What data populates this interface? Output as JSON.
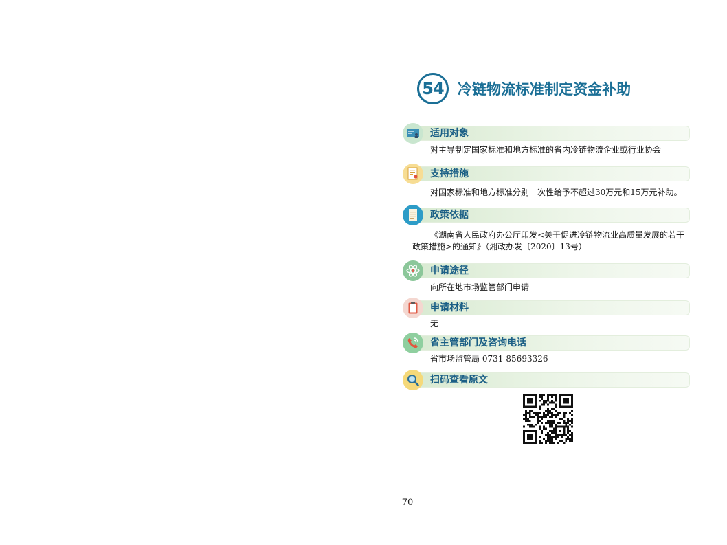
{
  "section_number": "54",
  "title": "冷链物流标准制定资金补助",
  "sections": [
    {
      "label": "适用对象",
      "icon": "id-card-icon",
      "lines": [
        "对主导制定国家标准和地方标准的省内冷链物流企业或行业协会"
      ]
    },
    {
      "label": "支持措施",
      "icon": "certificate-icon",
      "lines": [
        " 对国家标准和地方标准分别一次性给予不超过30万元和15万元补助。"
      ]
    },
    {
      "label": "政策依据",
      "icon": "document-icon",
      "lines": [
        "《湖南省人民政府办公厅印发<关于促进冷链物流业高质量发展的若干",
        "政策措施>的通知》（湘政办发〔2020〕13号）"
      ]
    },
    {
      "label": "申请途径",
      "icon": "atom-icon",
      "lines": [
        "向所在地市场监管部门申请"
      ]
    },
    {
      "label": "申请材料",
      "icon": "clipboard-icon",
      "lines": [
        "无"
      ]
    },
    {
      "label": "省主管部门及咨询电话",
      "icon": "phone-icon",
      "lines": [
        "省市场监管局 0731-85693326"
      ]
    },
    {
      "label": "扫码查看原文",
      "icon": "magnifier-icon",
      "lines": []
    }
  ],
  "colors": {
    "accent": "#1b6f96",
    "section_label": "#1b5f86",
    "bar": "#d8ead1"
  },
  "page_number": "70"
}
